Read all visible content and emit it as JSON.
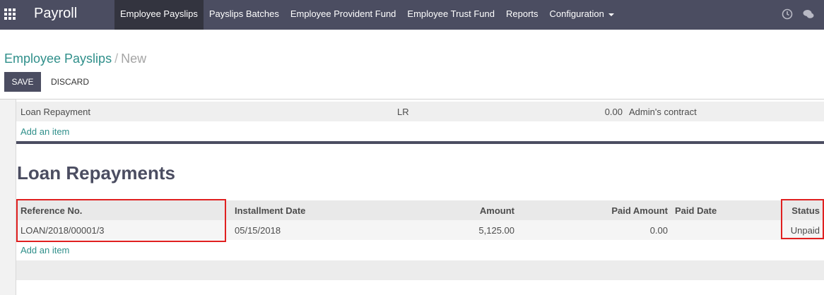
{
  "navbar": {
    "brand": "Payroll",
    "menu": [
      {
        "label": "Employee Payslips",
        "active": true
      },
      {
        "label": "Payslips Batches",
        "active": false
      },
      {
        "label": "Employee Provident Fund",
        "active": false
      },
      {
        "label": "Employee Trust Fund",
        "active": false
      },
      {
        "label": "Reports",
        "active": false
      },
      {
        "label": "Configuration",
        "active": false,
        "dropdown": true
      }
    ],
    "systray": [
      "clock-icon",
      "chat-icon"
    ]
  },
  "breadcrumb": {
    "parent": "Employee Payslips",
    "separator": "/",
    "current": "New"
  },
  "buttons": {
    "save": "SAVE",
    "discard": "DISCARD"
  },
  "loan_line": {
    "name": "Loan Repayment",
    "code": "LR",
    "amount": "0.00",
    "contract": "Admin's contract"
  },
  "add_item_label": "Add an item",
  "section": {
    "title": "Loan Repayments",
    "columns": {
      "reference": "Reference No.",
      "installment_date": "Installment Date",
      "amount": "Amount",
      "paid_amount": "Paid Amount",
      "paid_date": "Paid Date",
      "status": "Status"
    },
    "rows": [
      {
        "reference": "LOAN/2018/00001/3",
        "installment_date": "05/15/2018",
        "amount": "5,125.00",
        "paid_amount": "0.00",
        "paid_date": "",
        "status": "Unpaid"
      }
    ]
  },
  "colors": {
    "navbar": "#4b4d61",
    "active_menu": "#33343f",
    "link": "#2f8f8a",
    "highlight": "#e02020"
  }
}
